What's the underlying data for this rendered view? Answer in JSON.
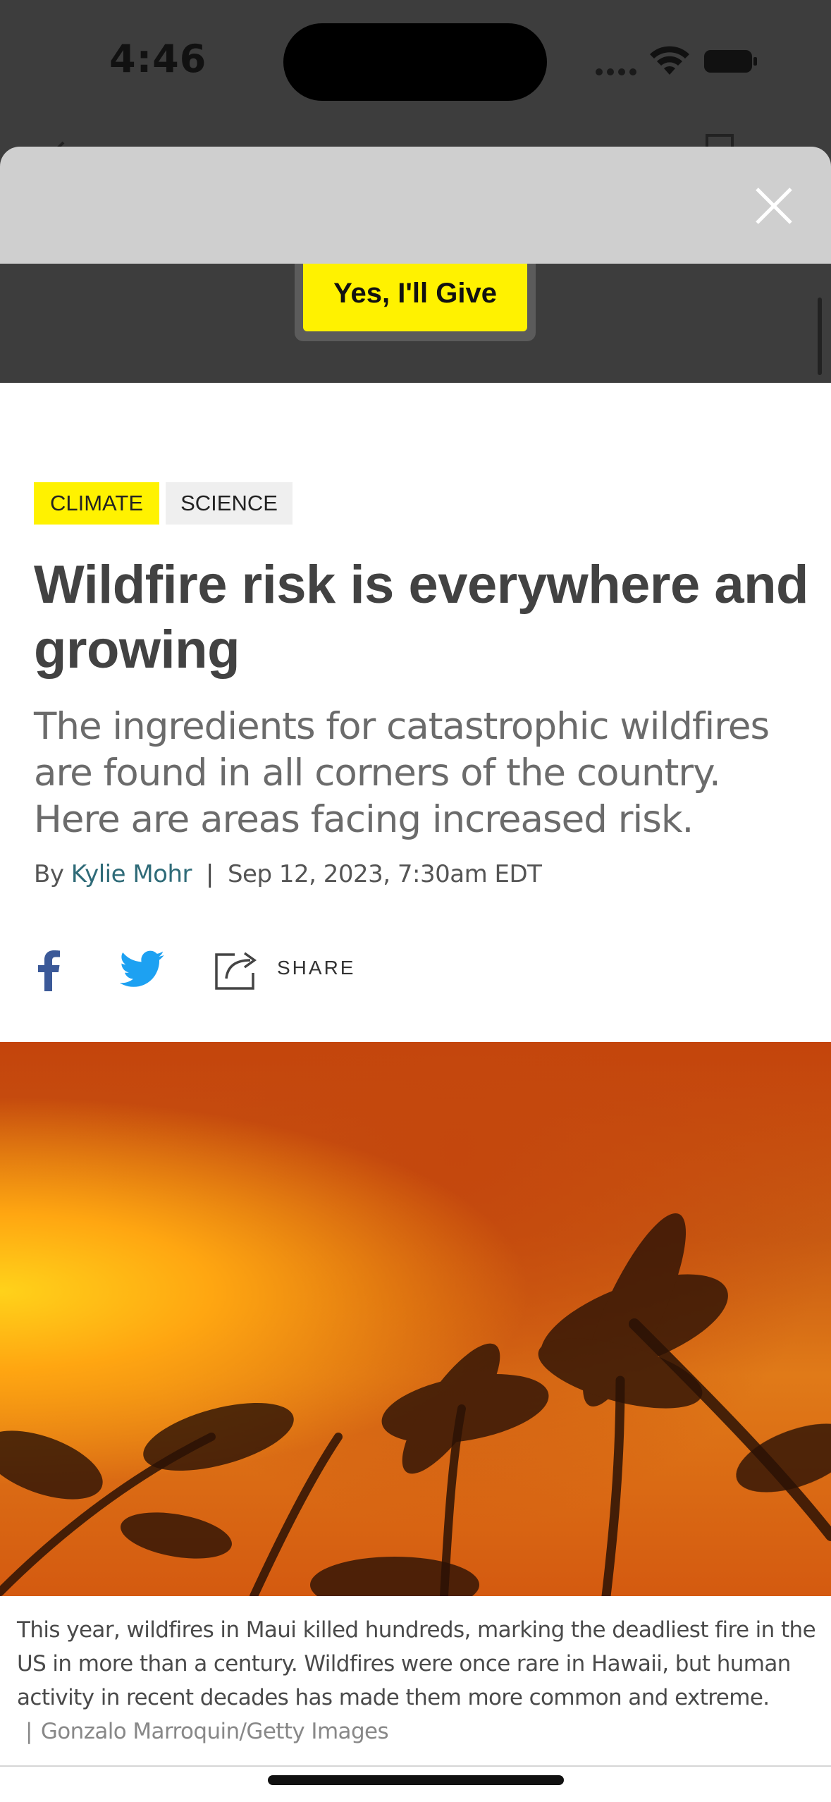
{
  "status_bar": {
    "time": "4:46"
  },
  "donate": {
    "button_label": "Yes, I'll Give"
  },
  "article": {
    "tags": [
      "CLIMATE",
      "SCIENCE"
    ],
    "headline": "Wildfire risk is everywhere and growing",
    "dek": "The ingredients for catastrophic wildfires are found in all corners of the country. Here are areas facing increased risk.",
    "byline": {
      "prefix": "By",
      "author": "Kylie Mohr",
      "separator": "|",
      "date": "Sep 12, 2023, 7:30am EDT"
    },
    "share": {
      "label": "SHARE"
    },
    "image": {
      "caption": "This year, wildfires in Maui killed hundreds, marking the deadliest fire in the US in more than a century. Wildfires were once rare in Hawaii, but human activity in recent decades has made them more common and extreme.",
      "credit_separator": "|",
      "credit": "Gonzalo Marroquin/Getty Images"
    }
  },
  "icons": {
    "close": "close-icon",
    "facebook": "facebook-icon",
    "twitter": "twitter-icon",
    "share": "share-icon",
    "back": "chevron-left-icon",
    "bookmark": "bookmark-icon"
  },
  "colors": {
    "accent_yellow": "#fff200",
    "author_link": "#2f6b78",
    "facebook_blue": "#3b5998",
    "twitter_blue": "#1da1f2"
  }
}
